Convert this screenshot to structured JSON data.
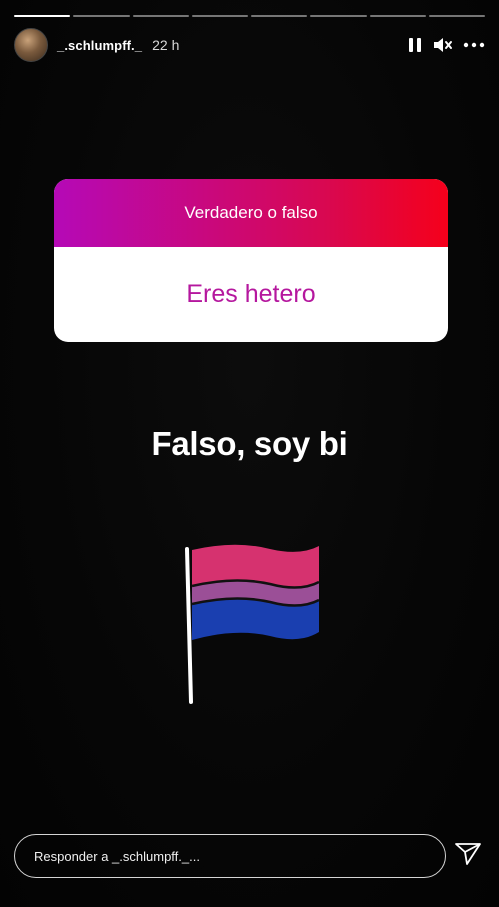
{
  "story": {
    "progress_segments": 8,
    "active_segment": 0
  },
  "header": {
    "username": "_.schlumpff._",
    "time": "22 h",
    "icons": [
      "pause-icon",
      "mute-icon",
      "more-icon"
    ]
  },
  "sticker": {
    "question": "Verdadero o falso",
    "statement": "Eres hetero",
    "gradient_colors": [
      "#b509b7",
      "#d9084f",
      "#f5001b"
    ],
    "statement_color": "#b5179e"
  },
  "answer_text": "Falso, soy bi",
  "flag": {
    "colors": [
      "#d6326f",
      "#9b4f97",
      "#1a3fb0"
    ]
  },
  "reply": {
    "placeholder": "Responder a _.schlumpff._...",
    "send_icon": "send-icon"
  }
}
